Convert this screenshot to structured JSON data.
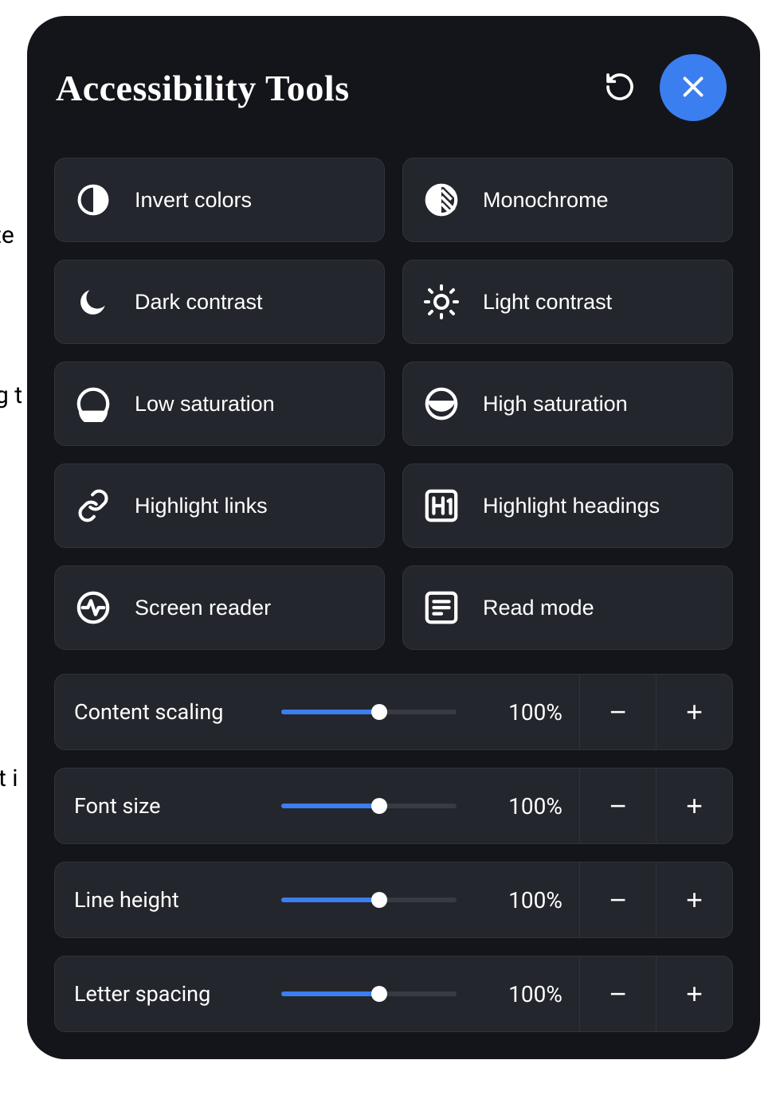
{
  "bg_text": {
    "a": "te",
    "b": "g t",
    "c": "t i"
  },
  "panel": {
    "title": "Accessibility Tools",
    "reset_label": "Reset",
    "close_label": "Close",
    "tools": [
      {
        "id": "invert-colors",
        "label": "Invert colors",
        "icon": "half-circle"
      },
      {
        "id": "monochrome",
        "label": "Monochrome",
        "icon": "monochrome"
      },
      {
        "id": "dark-contrast",
        "label": "Dark contrast",
        "icon": "moon"
      },
      {
        "id": "light-contrast",
        "label": "Light contrast",
        "icon": "sun"
      },
      {
        "id": "low-saturation",
        "label": "Low saturation",
        "icon": "low-sat"
      },
      {
        "id": "high-saturation",
        "label": "High saturation",
        "icon": "high-sat"
      },
      {
        "id": "highlight-links",
        "label": "Highlight links",
        "icon": "link"
      },
      {
        "id": "highlight-headings",
        "label": "Highlight headings",
        "icon": "h1"
      },
      {
        "id": "screen-reader",
        "label": "Screen reader",
        "icon": "activity"
      },
      {
        "id": "read-mode",
        "label": "Read mode",
        "icon": "read"
      }
    ],
    "sliders": [
      {
        "id": "content-scaling",
        "label": "Content scaling",
        "value": "100%",
        "percent": 56
      },
      {
        "id": "font-size",
        "label": "Font size",
        "value": "100%",
        "percent": 56
      },
      {
        "id": "line-height",
        "label": "Line height",
        "value": "100%",
        "percent": 56
      },
      {
        "id": "letter-spacing",
        "label": "Letter spacing",
        "value": "100%",
        "percent": 56
      }
    ],
    "minus_label": "−",
    "plus_label": "+"
  },
  "colors": {
    "accent": "#3b7ef0",
    "panel_bg": "#14151a",
    "tile_bg": "#24262d",
    "border": "#31333b"
  }
}
